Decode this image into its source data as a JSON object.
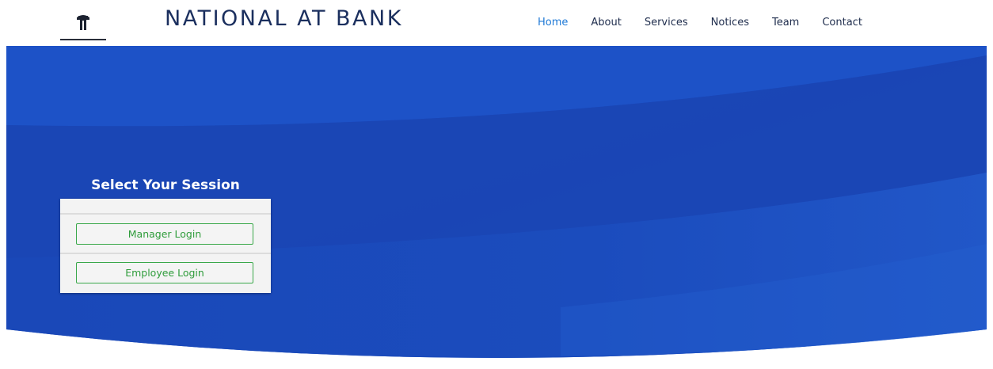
{
  "header": {
    "brand": "NATIONAL AT BANK",
    "logo_icon": "bank-pillar-logo"
  },
  "nav": {
    "items": [
      {
        "label": "Home",
        "active": true
      },
      {
        "label": "About",
        "active": false
      },
      {
        "label": "Services",
        "active": false
      },
      {
        "label": "Notices",
        "active": false
      },
      {
        "label": "Team",
        "active": false
      },
      {
        "label": "Contact",
        "active": false
      }
    ]
  },
  "session": {
    "title": "Select Your Session",
    "manager_label": "Manager Login",
    "employee_label": "Employee Login"
  },
  "colors": {
    "hero_blue": "#1b4fc0",
    "nav_active": "#1e79d6",
    "brand_text": "#1b2f5e",
    "login_green": "#2f9c3b"
  }
}
